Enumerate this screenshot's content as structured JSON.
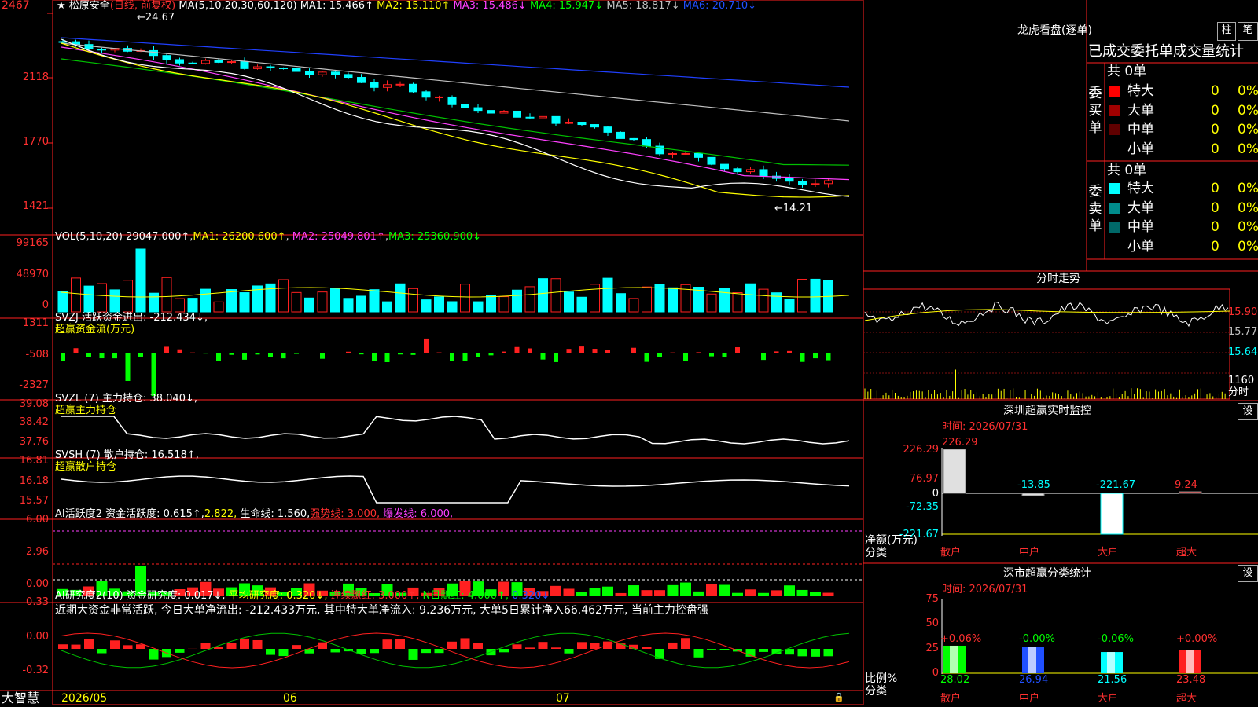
{
  "header": {
    "star": "★",
    "stock_name": "松原安全",
    "period": "(日线, 前复权)",
    "ma_prefix": "MA(5,10,20,30,60,120)",
    "ma1": "MA1: 15.466↑",
    "ma2": "MA2: 15.110↑",
    "ma3": "MA3: 15.486↓",
    "ma4": "MA4: 15.947↓",
    "ma5": "MA5: 18.817↓",
    "ma6": "MA6: 20.710↓",
    "max_label": "24.67",
    "min_label": "14.21"
  },
  "price_axis": [
    "2467",
    "2118",
    "1770",
    "1421"
  ],
  "vol": {
    "title": "VOL(5,10,20)",
    "value": "29047.000↑",
    "ma1": "MA1: 26200.600↑",
    "ma2": "MA2: 25049.801↑",
    "ma3": "MA3: 25360.900↓",
    "axis": [
      "99165",
      "48970",
      "0"
    ]
  },
  "svzj": {
    "title": "SVZJ  活跃资金进出: -212.434↓,",
    "subtitle": "超赢资金流(万元)",
    "axis": [
      "1311",
      "-508",
      "-2327"
    ]
  },
  "svzl": {
    "title": "SVZL (7) 主力持仓: 38.040↓,",
    "subtitle": "超赢主力持仓",
    "axis": [
      "39.08",
      "38.42",
      "37.76"
    ]
  },
  "svsh": {
    "title": "SVSH (7) 散户持仓: 16.518↑,",
    "subtitle": "超赢散户持仓",
    "axis": [
      "16.81",
      "16.18",
      "15.57"
    ]
  },
  "ai1": {
    "title": "AI活跃度2 资金活跃度: 0.615↑,",
    "v2": "2.822,",
    "life": "生命线: 1.560,",
    "strong": "强势线: 3.000,",
    "burst": "爆发线: 6.000,",
    "axis": [
      "6.00",
      "2.96",
      "0.00"
    ]
  },
  "ai2": {
    "title": "AI研究度2(10) 资金研究度: 0.017↓,",
    "avg": "平均研究度: 0.320↓,",
    "cont": "连续飘红: 3.000↑,",
    "nday": "N日飘红: 4.000↑,",
    "last": "0.320↓",
    "comment": "近期大资金非常活跃, 今日大单净流出: -212.433万元, 其中特大单净流入: 9.236万元, 大单5日累计净入66.462万元, 当前主力控盘强",
    "axis": [
      "0.33",
      "0.00",
      "-0.32"
    ]
  },
  "bottom": {
    "brand": "大智慧",
    "date1": "2026/05",
    "date2": "06",
    "date3": "07"
  },
  "dragon": {
    "title": "龙虎看盘(逐单)",
    "btn_bar": "柱",
    "btn_pen": "笔",
    "subtitle": "已成交委托单成交量统计",
    "buy": {
      "label": "委买单",
      "total": "共 0单",
      "rows": [
        {
          "name": "特大",
          "count": "0",
          "pct": "0%",
          "color": "#ff0000"
        },
        {
          "name": "大单",
          "count": "0",
          "pct": "0%",
          "color": "#a00000"
        },
        {
          "name": "中单",
          "count": "0",
          "pct": "0%",
          "color": "#600000"
        },
        {
          "name": "小单",
          "count": "0",
          "pct": "0%",
          "color": ""
        }
      ]
    },
    "sell": {
      "label": "委卖单",
      "total": "共 0单",
      "rows": [
        {
          "name": "特大",
          "count": "0",
          "pct": "0%",
          "color": "#00ffff"
        },
        {
          "name": "大单",
          "count": "0",
          "pct": "0%",
          "color": "#008c8c"
        },
        {
          "name": "中单",
          "count": "0",
          "pct": "0%",
          "color": "#006868"
        },
        {
          "name": "小单",
          "count": "0",
          "pct": "0%",
          "color": ""
        }
      ]
    }
  },
  "intraday": {
    "title": "分时走势",
    "axis": [
      "15.90",
      "15.77",
      "15.64",
      "1160",
      "分时"
    ]
  },
  "sz_monitor": {
    "title": "深圳超赢实时监控",
    "settings": "设",
    "time": "时间: 2026/07/31",
    "axis": [
      "226.29",
      "76.97",
      "0",
      "-72.35",
      "-221.67"
    ],
    "ylabel1": "净额(万元)",
    "ylabel2": "分类",
    "bars": [
      {
        "name": "散户",
        "value": "226.29"
      },
      {
        "name": "中户",
        "value": "-13.85"
      },
      {
        "name": "大户",
        "value": "-221.67"
      },
      {
        "name": "超大",
        "value": "9.24"
      }
    ]
  },
  "sz_stats": {
    "title": "深市超赢分类统计",
    "settings": "设",
    "time": "时间: 2026/07/31",
    "axis": [
      "75",
      "50",
      "25",
      "0"
    ],
    "ylabel1": "比例%",
    "ylabel2": "分类",
    "bars": [
      {
        "name": "散户",
        "value": "28.02",
        "change": "+0.06%"
      },
      {
        "name": "中户",
        "value": "26.94",
        "change": "-0.00%"
      },
      {
        "name": "大户",
        "value": "21.56",
        "change": "-0.06%"
      },
      {
        "name": "超大",
        "value": "23.48",
        "change": "+0.00%"
      }
    ]
  }
}
